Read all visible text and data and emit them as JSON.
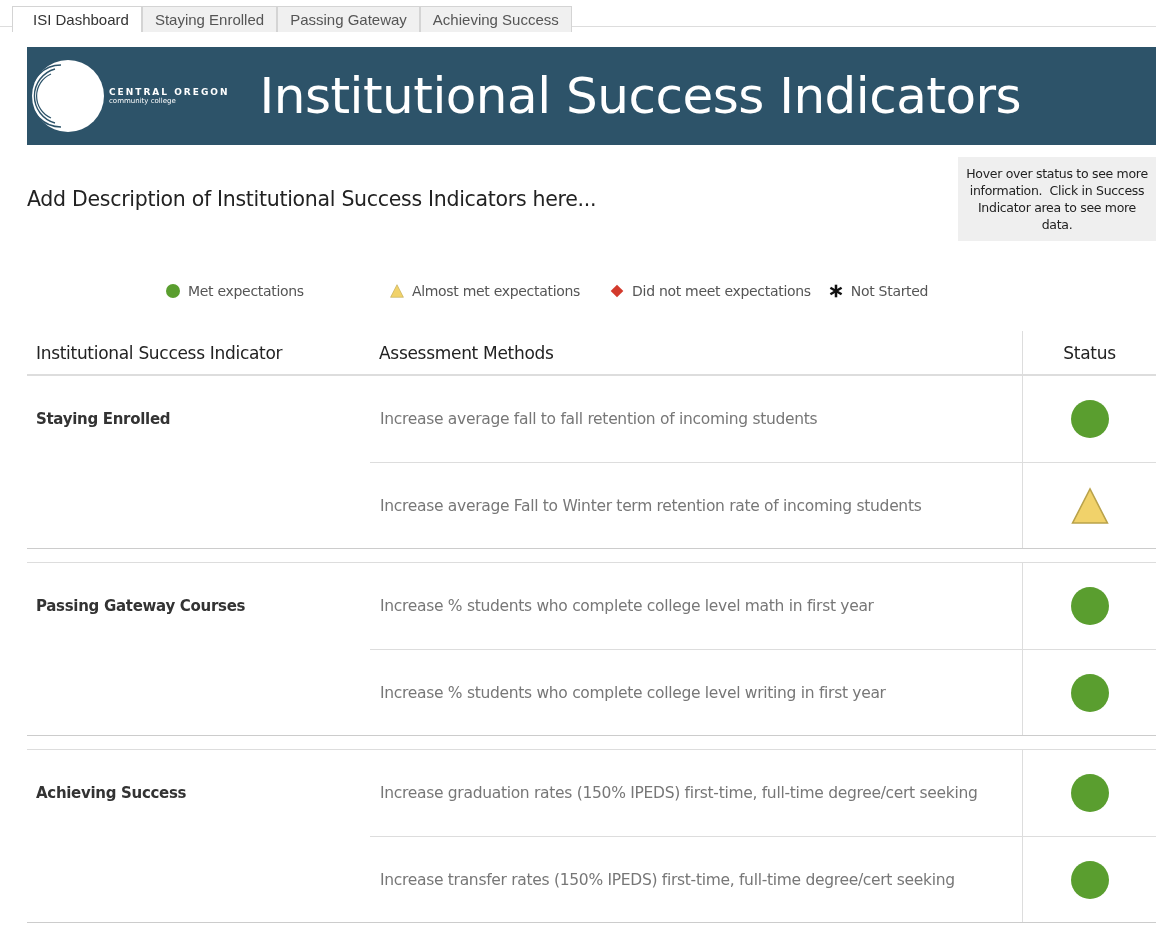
{
  "tabs": [
    {
      "label": "ISI Dashboard",
      "selected": true
    },
    {
      "label": "Staying Enrolled",
      "selected": false
    },
    {
      "label": "Passing Gateway",
      "selected": false
    },
    {
      "label": "Achieving Success",
      "selected": false
    }
  ],
  "banner": {
    "logo_line1": "CENTRAL OREGON",
    "logo_line2": "community college",
    "title": "Institutional Success Indicators"
  },
  "description": "Add Description of Institutional Success Indicators here...",
  "hint": "Hover over status to see more information.  Click in Success Indicator area to see more data.",
  "legend": [
    {
      "kind": "met",
      "label": "Met expectations"
    },
    {
      "kind": "almost",
      "label": "Almost met expectations"
    },
    {
      "kind": "not_met",
      "label": "Did not meet expectations"
    },
    {
      "kind": "not_started",
      "label": "Not Started"
    }
  ],
  "table": {
    "columns": [
      "Institutional Success Indicator",
      "Assessment Methods",
      "Status"
    ],
    "groups": [
      {
        "indicator": "Staying Enrolled",
        "rows": [
          {
            "method": "Increase average fall to fall retention of incoming students",
            "kind": "met"
          },
          {
            "method": "Increase average Fall to Winter term retention rate of incoming students",
            "kind": "almost"
          }
        ]
      },
      {
        "indicator": "Passing Gateway Courses",
        "rows": [
          {
            "method": "Increase % students who complete college level math in first year",
            "kind": "met"
          },
          {
            "method": "Increase % students who complete college level writing in first year",
            "kind": "met"
          }
        ]
      },
      {
        "indicator": "Achieving Success",
        "rows": [
          {
            "method": "Increase graduation rates (150% IPEDS) first-time, full-time degree/cert seeking",
            "kind": "met"
          },
          {
            "method": "Increase transfer rates (150% IPEDS) first-time, full-time degree/cert seeking",
            "kind": "met"
          }
        ]
      }
    ]
  }
}
